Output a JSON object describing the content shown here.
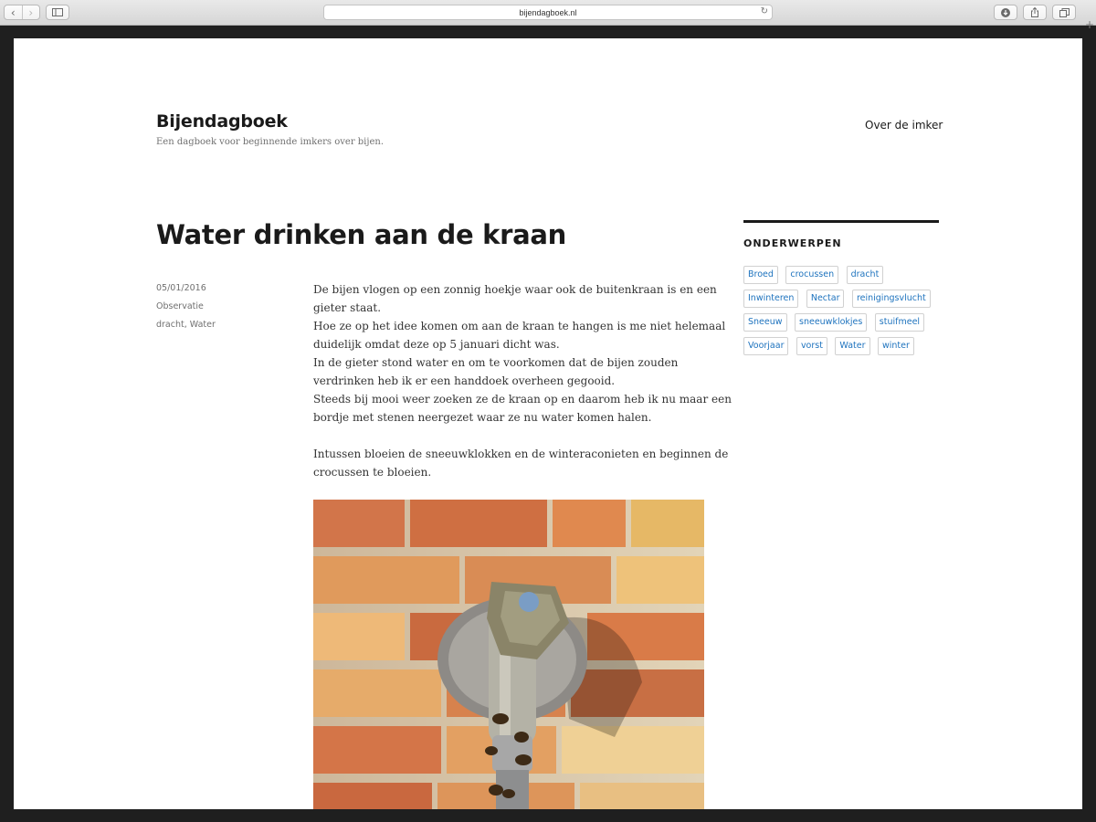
{
  "browser": {
    "url": "bijendagboek.nl",
    "reload_icon": "reload-icon",
    "back_icon": "chevron-left-icon",
    "forward_icon": "chevron-right-icon",
    "sidebar_icon": "sidebar-icon",
    "download_icon": "download-icon",
    "share_icon": "share-icon",
    "tabs_icon": "tabs-icon",
    "new_tab_icon": "plus-icon"
  },
  "site": {
    "title": "Bijendagboek",
    "description": "Een dagboek voor beginnende imkers over bijen.",
    "nav_items": [
      "Over de imker"
    ]
  },
  "post": {
    "title": "Water drinken aan de kraan",
    "date": "05/01/2016",
    "category": "Observatie",
    "tags": [
      "dracht",
      "Water"
    ],
    "tag_separator": ", ",
    "paragraphs": [
      [
        "De bijen vlogen op een zonnig hoekje waar ook de buitenkraan is en een",
        "gieter staat.",
        "Hoe ze op het idee komen om aan de kraan te hangen is me niet helemaal",
        "duidelijk omdat deze op 5 januari dicht was.",
        "In de gieter stond water en om te voorkomen dat de bijen zouden",
        "verdrinken heb ik er een handdoek overheen gegooid.",
        "Steeds bij mooi weer zoeken ze de kraan op en daarom heb ik nu maar een",
        "bordje met stenen neergezet waar ze nu water komen halen."
      ],
      [
        "Intussen bloeien de sneeuwklokken en de winteraconieten en beginnen de",
        "crocussen te bloeien."
      ]
    ]
  },
  "sidebar": {
    "widget_title": "ONDERWERPEN",
    "tags": [
      "Broed",
      "crocussen",
      "dracht",
      "Inwinteren",
      "Nectar",
      "reinigingsvlucht",
      "Sneeuw",
      "sneeuwklokjes",
      "stuifmeel",
      "Voorjaar",
      "vorst",
      "Water",
      "winter"
    ],
    "tag_color": "#1e73be"
  }
}
